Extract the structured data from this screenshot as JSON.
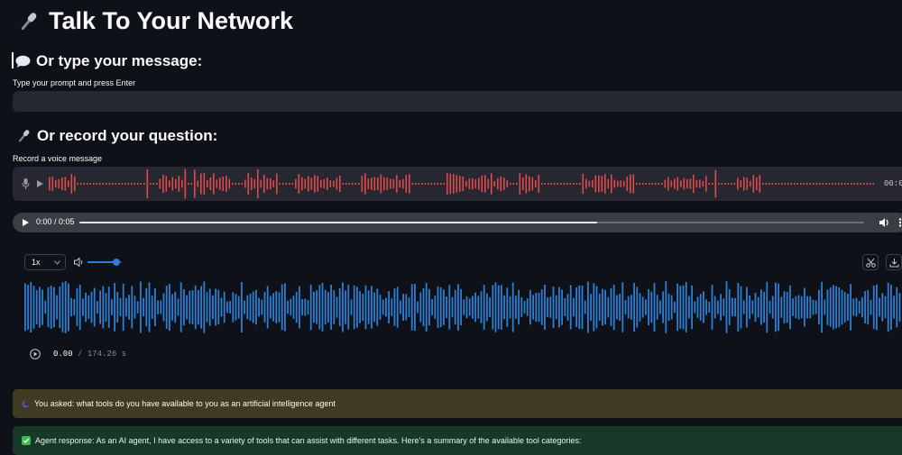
{
  "page": {
    "title": "Talk To Your Network",
    "title_icon": "microphone-icon"
  },
  "type_section": {
    "heading": "Or type your message:",
    "heading_icon": "speech-bubble-icon",
    "input_label": "Type your prompt and press Enter",
    "input_value": ""
  },
  "record_section": {
    "heading": "Or record your question:",
    "heading_icon": "microphone-icon",
    "recorder_label": "Record a voice message",
    "recorder_time": "00:0",
    "recorder_color": "#e04a4a"
  },
  "audio_player": {
    "time": "0:00 / 0:05",
    "progress": 0.66
  },
  "waveform_player": {
    "speed": "1x",
    "volume": 0.85,
    "current_time": "0.00",
    "separator": "/",
    "duration": "174.26 s",
    "wave_color": "#2b7fd4"
  },
  "messages": {
    "asked": "You asked: what tools do you have available to you as an artificial intelligence agent",
    "response": "Agent response: As an AI agent, I have access to a variety of tools that can assist with different tasks. Here's a summary of the available tool categories:"
  }
}
